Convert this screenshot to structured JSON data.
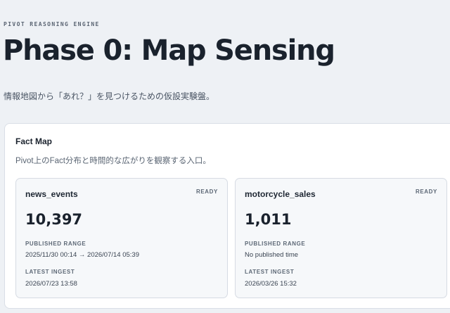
{
  "header": {
    "eyebrow": "PIVOT REASONING ENGINE",
    "title": "Phase 0: Map Sensing",
    "subtitle": "情報地図から「あれ？」を見つけるための仮設実験盤。"
  },
  "fact_map": {
    "title": "Fact Map",
    "description": "Pivot上のFact分布と時間的な広がりを観察する入口。",
    "cards": [
      {
        "name": "news_events",
        "status": "READY",
        "count": "10,397",
        "published_range_label": "PUBLISHED RANGE",
        "published_range": "2025/11/30 00:14 → 2026/07/14 05:39",
        "latest_ingest_label": "LATEST INGEST",
        "latest_ingest": "2026/07/23 13:58"
      },
      {
        "name": "motorcycle_sales",
        "status": "READY",
        "count": "1,011",
        "published_range_label": "PUBLISHED RANGE",
        "published_range": "No published time",
        "latest_ingest_label": "LATEST INGEST",
        "latest_ingest": "2026/03/26 15:32"
      }
    ]
  }
}
